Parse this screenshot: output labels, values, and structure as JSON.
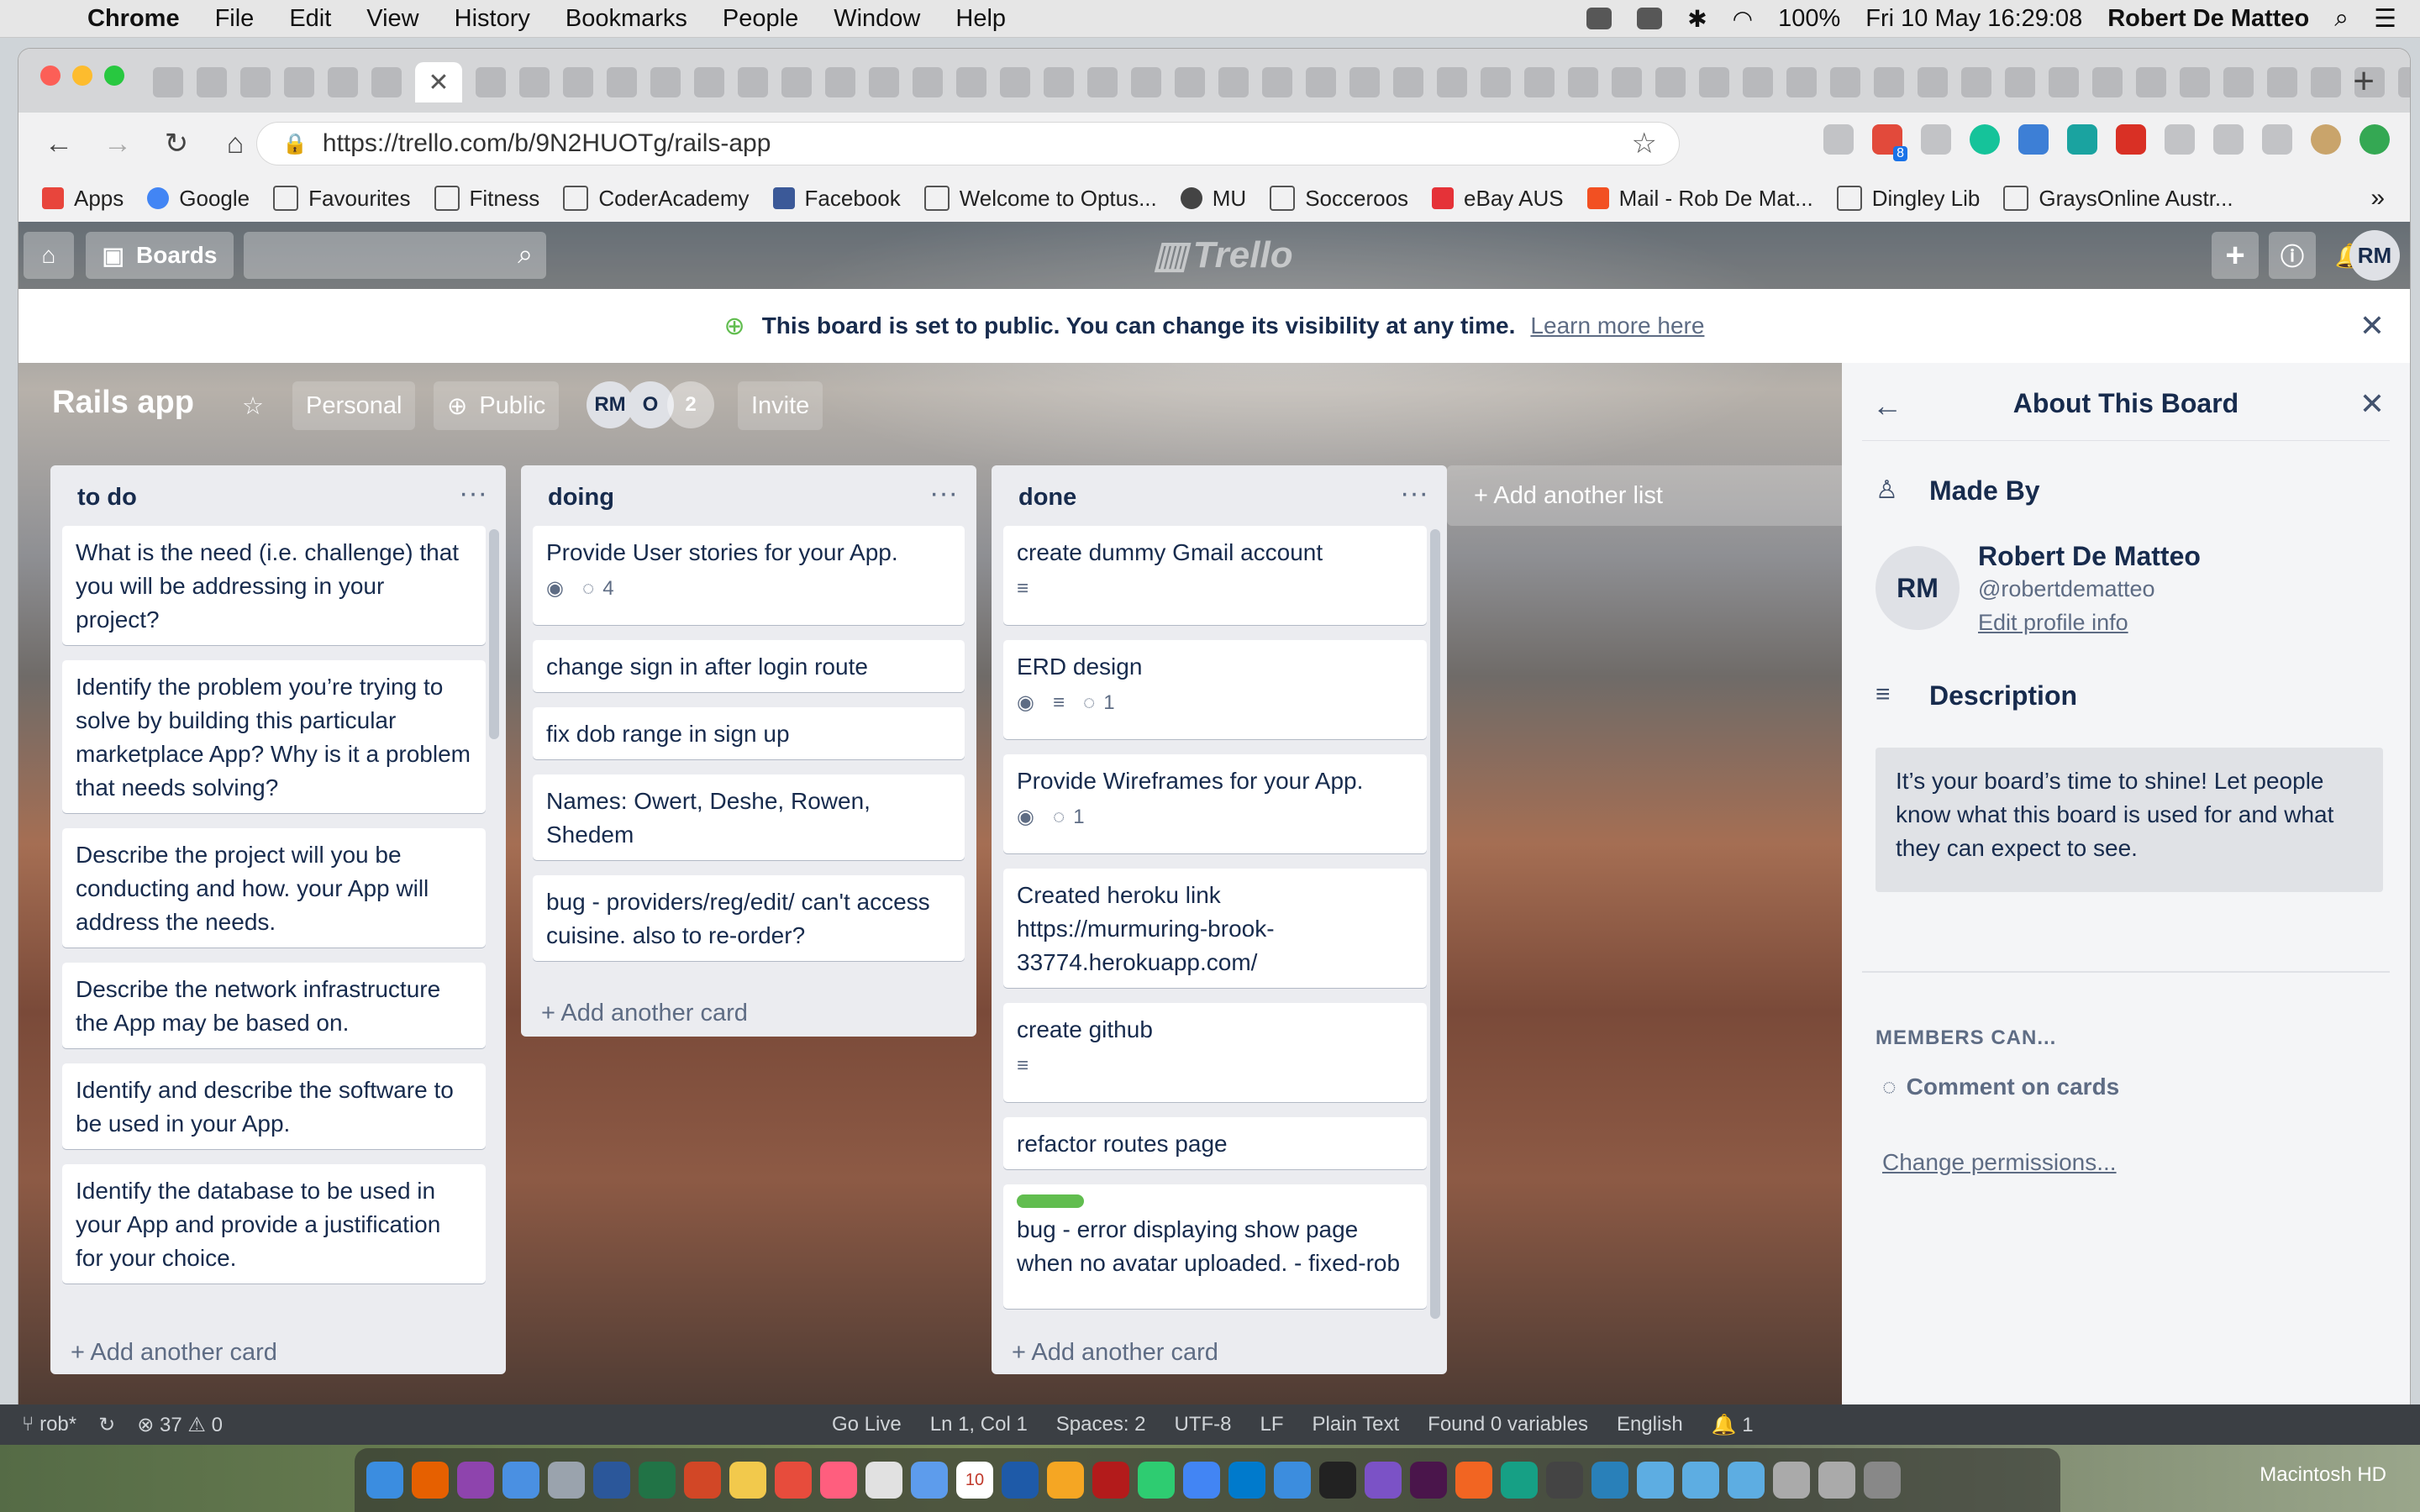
{
  "menubar": {
    "app": "Chrome",
    "items": [
      "File",
      "Edit",
      "View",
      "History",
      "Bookmarks",
      "People",
      "Window",
      "Help"
    ],
    "battery": "100%",
    "clock": "Fri 10 May  16:29:08",
    "user": "Robert De Matteo"
  },
  "browser": {
    "url": "https://trello.com/b/9N2HUOTg/rails-app",
    "bookmarks": [
      "Apps",
      "Google",
      "Favourites",
      "Fitness",
      "CoderAcademy",
      "Facebook",
      "Welcome to Optus...",
      "MU",
      "Socceroos",
      "eBay AUS",
      "Mail - Rob De Mat...",
      "Dingley Lib",
      "GraysOnline Austr..."
    ],
    "bookmarks_more": "»",
    "extension_badge": "8"
  },
  "trello": {
    "boards_label": "Boards",
    "logo": "Trello",
    "avatar": "RM"
  },
  "banner": {
    "message": "This board is set to public. You can change its visibility at any time.",
    "link": "Learn more here"
  },
  "board": {
    "title": "Rails app",
    "team": "Personal",
    "visibility": "Public",
    "members": [
      "RM",
      "O"
    ],
    "member_count": "2",
    "invite": "Invite"
  },
  "lists": [
    {
      "title": "to do",
      "add_card": "+ Add another card",
      "cards": [
        {
          "text": "What is the need (i.e. challenge) that you will be addressing in your project?"
        },
        {
          "text": "Identify the problem you’re trying to solve by building this particular marketplace App? Why is it a problem that needs solving?"
        },
        {
          "text": "Describe the project will you be conducting and how. your App will address the needs."
        },
        {
          "text": "Describe the network infrastructure the App may be based on."
        },
        {
          "text": "Identify and describe the software to be used in your App."
        },
        {
          "text": "Identify the database to be used in your App and provide a justification for your choice."
        }
      ]
    },
    {
      "title": "doing",
      "add_card": "+ Add another card",
      "cards": [
        {
          "text": "Provide User stories for your App.",
          "comments": "4"
        },
        {
          "text": "change sign in after login route"
        },
        {
          "text": "fix dob range in sign up"
        },
        {
          "text": "Names: Owert, Deshe, Rowen, Shedem"
        },
        {
          "text": "bug - providers/reg/edit/ can't access cuisine. also to re-order?"
        }
      ]
    },
    {
      "title": "done",
      "add_card": "+ Add another card",
      "cards": [
        {
          "text": "create dummy Gmail account"
        },
        {
          "text": "ERD design",
          "comments": "1"
        },
        {
          "text": "Provide Wireframes for your App.",
          "comments": "1"
        },
        {
          "text": "Created heroku link https://murmuring-brook-33774.herokuapp.com/"
        },
        {
          "text": "create github"
        },
        {
          "text": "refactor routes page"
        },
        {
          "text": "bug - error displaying show page when no avatar uploaded. - fixed-rob",
          "label_color": "#61bd4f"
        }
      ]
    }
  ],
  "add_list": "+ Add another list",
  "sidebar": {
    "title": "About This Board",
    "made_by_label": "Made By",
    "avatar": "RM",
    "name": "Robert De Matteo",
    "handle": "@robertdematteo",
    "edit_profile": "Edit profile info",
    "description_label": "Description",
    "description": "It’s your board’s time to shine! Let people know what this board is used for and what they can expect to see.",
    "members_can": "MEMBERS CAN...",
    "comment_on_cards": "Comment on cards",
    "change_permissions": "Change permissions..."
  },
  "statusbar": {
    "branch": "rob*",
    "problems": "37",
    "warnings": "0",
    "items": [
      "Go Live",
      "Ln 1, Col 1",
      "Spaces: 2",
      "UTF-8",
      "LF",
      "Plain Text",
      "Found 0 variables",
      "English"
    ],
    "bell_count": "1"
  },
  "dock": {
    "calendar_day": "10",
    "disk_label": "Macintosh HD"
  },
  "colors": {
    "trello_green": "#61bd4f",
    "list_bg": "#ebecf0",
    "card_text": "#172b4d"
  }
}
